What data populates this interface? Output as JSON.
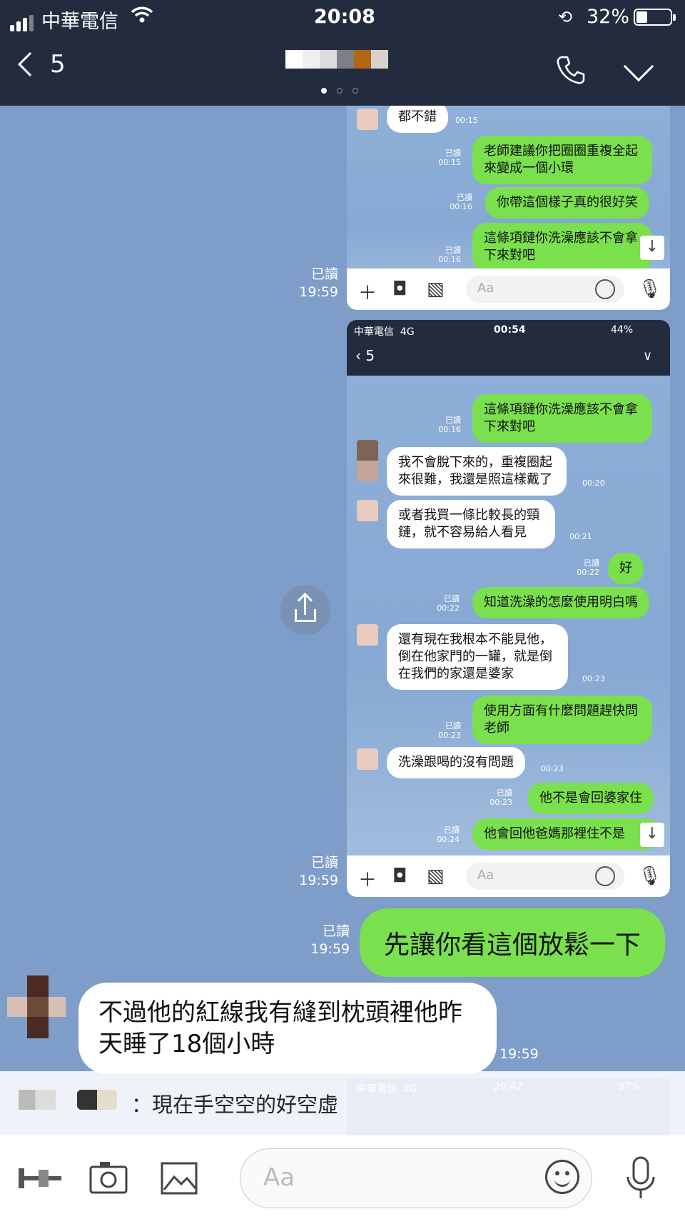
{
  "status_bar": {
    "carrier": "中華電信",
    "time": "20:08",
    "battery_pct": "32%",
    "battery_level": 0.32,
    "icons": [
      "signal-icon",
      "wifi-icon",
      "rotation-lock-icon",
      "battery-icon"
    ]
  },
  "header": {
    "back_count": "5",
    "title_redacted": true,
    "title_colors": [
      "#ffffff",
      "#efefef",
      "#dcdcdc",
      "#7d7f86",
      "#b06612",
      "#d8d2cb"
    ],
    "page_dots": 3,
    "icons": [
      "back-chevron-icon",
      "phone-icon",
      "chevron-down-icon"
    ]
  },
  "screenshot1": {
    "messages": [
      {
        "side": "left",
        "text": "都不錯",
        "time": "00:15"
      },
      {
        "side": "right",
        "text": "老師建議你把圈圈重複全起來變成一個小環",
        "read": "已讀",
        "time": "00:15"
      },
      {
        "side": "right",
        "text": "你帶這個樣子真的很好笑",
        "read": "已讀",
        "time": "00:16"
      },
      {
        "side": "right",
        "text": "這條項鏈你洗澡應該不會拿下來對吧",
        "read": "已讀",
        "time": "00:16"
      }
    ],
    "input_placeholder": "Aa",
    "read": "已讀",
    "time": "19:59"
  },
  "screenshot2": {
    "status": {
      "carrier": "中華電信",
      "network": "4G",
      "time": "00:54",
      "battery": "44%"
    },
    "back_count": "5",
    "messages": [
      {
        "side": "right",
        "text": "這條項鏈你洗澡應該不會拿下來對吧",
        "read": "已讀",
        "time": "00:16"
      },
      {
        "side": "left",
        "text": "我不會脫下來的，重複圈起來很難，我還是照這樣戴了",
        "time": "00:20"
      },
      {
        "side": "left",
        "text": "或者我買一條比較長的頸鏈，就不容易給人看見",
        "time": "00:21"
      },
      {
        "side": "right",
        "text": "好",
        "read": "已讀",
        "time": "00:22"
      },
      {
        "side": "right",
        "text": "知道洗澡的怎麼使用明白嗎",
        "read": "已讀",
        "time": "00:22"
      },
      {
        "side": "left",
        "text": "還有現在我根本不能見他，倒在他家門的一罐，就是倒在我們的家還是婆家",
        "time": "00:23"
      },
      {
        "side": "right",
        "text": "使用方面有什麼問題趕快問老師",
        "read": "已讀",
        "time": "00:23"
      },
      {
        "side": "left",
        "text": "洗澡跟喝的沒有問題",
        "time": "00:23"
      },
      {
        "side": "right",
        "text": "他不是會回婆家住",
        "read": "已讀",
        "time": "00:23"
      },
      {
        "side": "right",
        "text": "他會回他爸媽那裡住不是",
        "read": "已讀",
        "time": "00:24"
      }
    ],
    "input_placeholder": "Aa",
    "read": "已讀",
    "time": "19:59"
  },
  "main_messages": [
    {
      "side": "right",
      "text": "先讓你看這個放鬆一下",
      "read": "已讀",
      "time": "19:59"
    },
    {
      "side": "left",
      "text": "不過他的紅線我有縫到枕頭裡他昨天睡了18個小時",
      "time": "19:59"
    }
  ],
  "notification": {
    "text": "：現在手空空的好空虛",
    "ghost_status": {
      "carrier": "中華電信",
      "network": "3G",
      "time": "20:42",
      "battery": "37%"
    }
  },
  "bottom_bar": {
    "placeholder": "Aa",
    "icons": [
      "more-icon",
      "camera-icon",
      "image-icon",
      "emoji-icon",
      "mic-icon"
    ]
  },
  "colors": {
    "header_bg": "#232c3f",
    "chat_bg": "#7e9dc8",
    "green_bubble": "#7ae04d",
    "white_bubble": "#ffffff"
  }
}
